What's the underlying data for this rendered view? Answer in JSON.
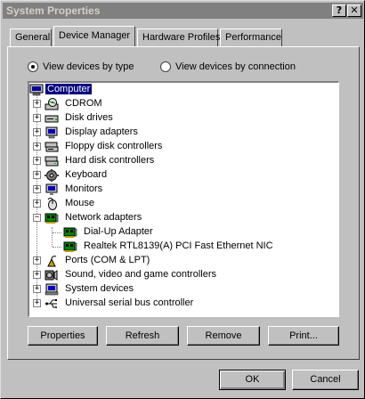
{
  "window": {
    "title": "System Properties",
    "help_glyph": "?",
    "close_glyph": "✕"
  },
  "tabs": [
    {
      "label": "General",
      "active": false
    },
    {
      "label": "Device Manager",
      "active": true
    },
    {
      "label": "Hardware Profiles",
      "active": false
    },
    {
      "label": "Performance",
      "active": false
    }
  ],
  "view_options": {
    "by_type": {
      "label": "View devices by type",
      "checked": true
    },
    "by_connection": {
      "label": "View devices by connection",
      "checked": false
    }
  },
  "tree": {
    "root": {
      "label": "Computer",
      "icon": "computer-icon",
      "selected": true
    },
    "items": [
      {
        "label": "CDROM",
        "icon": "cdrom-icon",
        "expander": "+"
      },
      {
        "label": "Disk drives",
        "icon": "disk-drive-icon",
        "expander": "+"
      },
      {
        "label": "Display adapters",
        "icon": "display-adapter-icon",
        "expander": "+"
      },
      {
        "label": "Floppy disk controllers",
        "icon": "floppy-controller-icon",
        "expander": "+"
      },
      {
        "label": "Hard disk controllers",
        "icon": "hard-disk-controller-icon",
        "expander": "+"
      },
      {
        "label": "Keyboard",
        "icon": "keyboard-icon",
        "expander": "+"
      },
      {
        "label": "Monitors",
        "icon": "monitor-icon",
        "expander": "+"
      },
      {
        "label": "Mouse",
        "icon": "mouse-icon",
        "expander": "+"
      },
      {
        "label": "Network adapters",
        "icon": "network-adapter-icon",
        "expander": "−",
        "children": [
          {
            "label": "Dial-Up Adapter",
            "icon": "network-card-icon"
          },
          {
            "label": "Realtek RTL8139(A) PCI Fast Ethernet NIC",
            "icon": "network-card-icon"
          }
        ]
      },
      {
        "label": "Ports (COM & LPT)",
        "icon": "port-icon",
        "expander": "+"
      },
      {
        "label": "Sound, video and game controllers",
        "icon": "sound-icon",
        "expander": "+"
      },
      {
        "label": "System devices",
        "icon": "system-device-icon",
        "expander": "+"
      },
      {
        "label": "Universal serial bus controller",
        "icon": "usb-icon",
        "expander": "+"
      }
    ]
  },
  "buttons": {
    "properties": "Properties",
    "refresh": "Refresh",
    "remove": "Remove",
    "print": "Print...",
    "ok": "OK",
    "cancel": "Cancel"
  },
  "colors": {
    "selection": "#000080",
    "face": "#c0c0c0",
    "titlebar_inactive": "#808080"
  }
}
